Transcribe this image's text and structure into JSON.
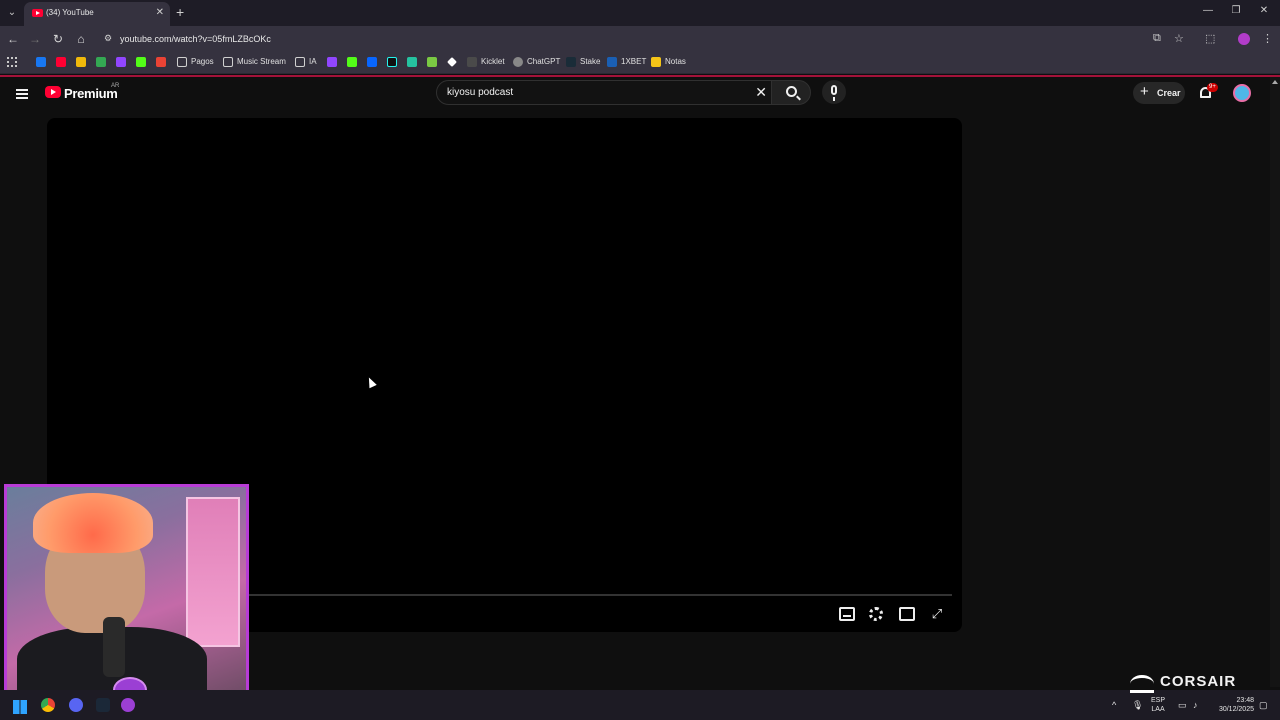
{
  "browser": {
    "tab_title": "(34) YouTube",
    "url": "youtube.com/watch?v=05fmLZBcOKc",
    "bookmarks": [
      "Pagos",
      "Music Stream",
      "IA",
      "Kicklet",
      "ChatGPT",
      "Stake",
      "1XBET",
      "Notas"
    ]
  },
  "youtube": {
    "logo_text": "Premium",
    "country_code": "AR",
    "search_query": "kiyosu podcast",
    "create_label": "Crear",
    "notification_badge": "9+"
  },
  "overlay": {
    "brand": "CORSAIR"
  },
  "taskbar": {
    "language_line1": "ESP",
    "language_line2": "LAA",
    "time": "23:48",
    "date": "30/12/2025"
  },
  "colors": {
    "youtube_red": "#ff0033",
    "webcam_border": "#b83cd6",
    "accent_line": "#a3123a"
  }
}
